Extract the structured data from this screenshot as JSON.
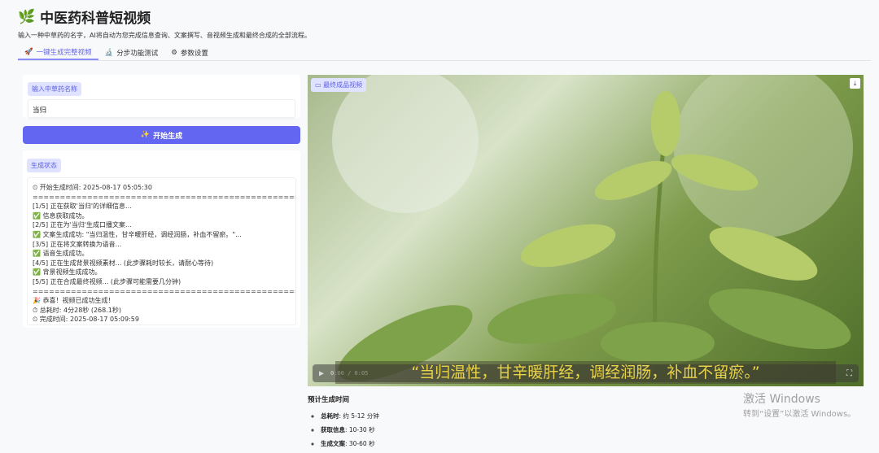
{
  "header": {
    "title": "中医药科普短视频",
    "description": "输入一种中草药的名字，AI将自动为您完成信息查询、文案撰写、音视频生成和最终合成的全部流程。"
  },
  "tabs": [
    {
      "label": "一键生成完整视频",
      "icon": "🚀"
    },
    {
      "label": "分步功能测试",
      "icon": "🔬"
    },
    {
      "label": "参数设置",
      "icon": "⚙"
    }
  ],
  "input": {
    "label": "输入中草药名称",
    "value": "当归"
  },
  "generate_button": {
    "label": "开始生成",
    "icon": "✨"
  },
  "status": {
    "label": "生成状态",
    "log": "⏲ 开始生成时间: 2025-08-17 05:05:30\n==================================================\n[1/5] 正在获取'当归'的详细信息...\n✅ 信息获取成功。\n[2/5] 正在为'当归'生成口播文案...\n✅ 文案生成成功: \"当归温性，甘辛暖肝经，调经润肠，补血不留瘀。\"...\n[3/5] 正在将文案转换为语音...\n✅ 语音生成成功。\n[4/5] 正在生成背景视频素材... (此步骤耗时较长，请耐心等待)\n✅ 背景视频生成成功。\n[5/5] 正在合成最终视频... (此步骤可能需要几分钟)\n==================================================\n🎉 恭喜！视频已成功生成！\n⏱ 总耗时: 4分28秒 (268.1秒)\n⏲ 完成时间: 2025-08-17 05:09:59"
  },
  "video": {
    "label": "最终成品视频",
    "time": "0:00 / 0:05",
    "subtitle": "“当归温性，甘辛暖肝经，调经润肠，补血不留瘀。”",
    "progress": 0
  },
  "estimate": {
    "title": "预计生成时间",
    "items": [
      {
        "k": "总耗时",
        "v": ": 约 5-12 分钟"
      },
      {
        "k": "获取信息",
        "v": ": 10-30 秒"
      },
      {
        "k": "生成文案",
        "v": ": 30-60 秒"
      }
    ]
  },
  "watermark": {
    "line1": "激活 Windows",
    "line2": "转到“设置”以激活 Windows。"
  }
}
